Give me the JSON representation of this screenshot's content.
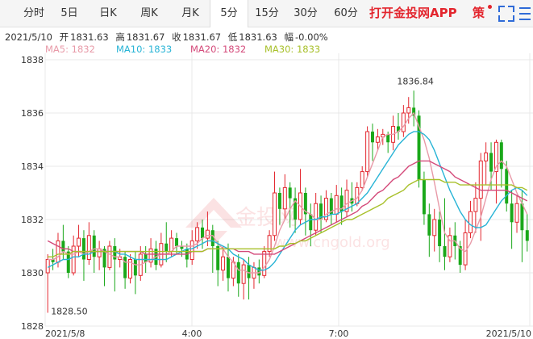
{
  "tabs": [
    "分时",
    "5日",
    "日K",
    "周K",
    "月K",
    "5分",
    "15分",
    "30分",
    "60分"
  ],
  "active_tab": 5,
  "app_link": "打开金投网APP",
  "strategy_label": "策",
  "quote": {
    "date": "2021/5/10",
    "open_label": "开",
    "open": "1831.63",
    "high_label": "高",
    "high": "1831.67",
    "close_label": "收",
    "close": "1831.67",
    "low_label": "低",
    "low": "1831.63",
    "range_label": "幅",
    "range": "-0.00%"
  },
  "ma": [
    {
      "label": "MA5: 1832",
      "color": "#e89aa8"
    },
    {
      "label": "MA10: 1833",
      "color": "#28b4d6"
    },
    {
      "label": "MA20: 1832",
      "color": "#d44a7a"
    },
    {
      "label": "MA30: 1833",
      "color": "#a8c02a"
    }
  ],
  "colors": {
    "up": "#e3262e",
    "down": "#1aa81a",
    "grid": "#e8e8e8",
    "watermark": "#e3262e"
  },
  "chart_data": {
    "type": "candlestick",
    "ylim": [
      1828,
      1838
    ],
    "yticks": [
      "1828",
      "1830",
      "1832",
      "1834",
      "1836",
      "1838"
    ],
    "xticks": [
      "2021/5/8",
      "4:00",
      "7:00",
      "2021/5/10"
    ],
    "max_label": "1836.84",
    "min_label": "1828.50",
    "candles": [
      [
        1830.0,
        1830.5,
        1828.5,
        1830.7
      ],
      [
        1830.5,
        1830.4,
        1830.1,
        1830.9
      ],
      [
        1830.4,
        1831.2,
        1830.2,
        1831.5
      ],
      [
        1831.2,
        1830.8,
        1830.5,
        1831.8
      ],
      [
        1830.8,
        1830.0,
        1829.8,
        1831.0
      ],
      [
        1830.0,
        1831.0,
        1829.9,
        1831.4
      ],
      [
        1831.0,
        1831.3,
        1830.6,
        1831.8
      ],
      [
        1831.3,
        1830.5,
        1829.7,
        1831.6
      ],
      [
        1830.5,
        1831.4,
        1830.3,
        1831.9
      ],
      [
        1831.4,
        1830.6,
        1830.0,
        1831.6
      ],
      [
        1830.6,
        1830.9,
        1830.1,
        1831.2
      ],
      [
        1830.9,
        1830.2,
        1829.5,
        1831.0
      ],
      [
        1830.2,
        1831.0,
        1830.1,
        1831.2
      ],
      [
        1831.0,
        1830.5,
        1829.3,
        1831.3
      ],
      [
        1830.5,
        1830.6,
        1830.2,
        1830.9
      ],
      [
        1830.6,
        1829.8,
        1829.4,
        1830.8
      ],
      [
        1829.8,
        1830.5,
        1829.6,
        1830.7
      ],
      [
        1830.5,
        1829.9,
        1829.2,
        1830.8
      ],
      [
        1829.9,
        1830.7,
        1829.7,
        1831.0
      ],
      [
        1830.7,
        1830.4,
        1830.0,
        1831.0
      ],
      [
        1830.4,
        1830.9,
        1830.2,
        1831.3
      ],
      [
        1830.9,
        1830.3,
        1830.1,
        1831.2
      ],
      [
        1830.3,
        1831.1,
        1830.2,
        1831.5
      ],
      [
        1831.1,
        1830.8,
        1830.4,
        1831.9
      ],
      [
        1830.8,
        1831.3,
        1830.6,
        1831.6
      ],
      [
        1831.3,
        1831.0,
        1830.7,
        1831.5
      ],
      [
        1831.0,
        1830.9,
        1830.6,
        1831.2
      ],
      [
        1830.9,
        1830.5,
        1830.2,
        1831.1
      ],
      [
        1830.5,
        1831.2,
        1830.3,
        1831.6
      ],
      [
        1831.2,
        1831.7,
        1830.9,
        1831.9
      ],
      [
        1831.7,
        1831.3,
        1830.9,
        1832.0
      ],
      [
        1831.3,
        1831.6,
        1831.0,
        1832.3
      ],
      [
        1831.6,
        1831.0,
        1830.0,
        1831.8
      ],
      [
        1831.0,
        1830.1,
        1829.5,
        1831.2
      ],
      [
        1830.1,
        1830.6,
        1829.7,
        1831.0
      ],
      [
        1830.6,
        1829.8,
        1829.3,
        1831.1
      ],
      [
        1829.8,
        1830.4,
        1829.5,
        1830.6
      ],
      [
        1830.4,
        1829.6,
        1829.1,
        1830.7
      ],
      [
        1829.6,
        1830.3,
        1829.0,
        1830.5
      ],
      [
        1830.3,
        1829.8,
        1829.0,
        1830.6
      ],
      [
        1829.8,
        1830.2,
        1829.4,
        1830.4
      ],
      [
        1830.2,
        1829.9,
        1829.6,
        1830.5
      ],
      [
        1829.9,
        1830.8,
        1829.8,
        1831.0
      ],
      [
        1830.8,
        1831.4,
        1830.6,
        1831.6
      ],
      [
        1831.4,
        1833.0,
        1831.2,
        1833.8
      ],
      [
        1833.0,
        1832.4,
        1831.8,
        1833.2
      ],
      [
        1832.4,
        1833.2,
        1832.0,
        1833.7
      ],
      [
        1833.2,
        1832.8,
        1831.7,
        1833.4
      ],
      [
        1832.8,
        1832.0,
        1831.5,
        1833.2
      ],
      [
        1832.0,
        1833.0,
        1831.8,
        1833.9
      ],
      [
        1833.0,
        1832.2,
        1831.4,
        1833.2
      ],
      [
        1832.2,
        1831.6,
        1831.0,
        1832.6
      ],
      [
        1831.6,
        1832.6,
        1831.4,
        1833.0
      ],
      [
        1832.6,
        1832.0,
        1831.5,
        1832.9
      ],
      [
        1832.0,
        1832.8,
        1831.9,
        1833.1
      ],
      [
        1832.8,
        1832.2,
        1831.8,
        1833.0
      ],
      [
        1832.2,
        1832.9,
        1831.9,
        1833.3
      ],
      [
        1832.9,
        1832.3,
        1831.8,
        1833.2
      ],
      [
        1832.3,
        1833.1,
        1832.1,
        1833.5
      ],
      [
        1832.8,
        1832.6,
        1832.3,
        1833.4
      ],
      [
        1832.6,
        1833.2,
        1832.5,
        1833.4
      ],
      [
        1833.2,
        1833.8,
        1833.1,
        1834.0
      ],
      [
        1833.8,
        1835.3,
        1833.6,
        1835.5
      ],
      [
        1835.3,
        1834.9,
        1834.2,
        1835.6
      ],
      [
        1834.9,
        1835.1,
        1834.6,
        1835.4
      ],
      [
        1835.1,
        1835.2,
        1834.8,
        1835.4
      ],
      [
        1835.2,
        1834.9,
        1834.5,
        1835.3
      ],
      [
        1834.9,
        1835.5,
        1834.6,
        1835.9
      ],
      [
        1835.5,
        1835.3,
        1835.0,
        1836.0
      ],
      [
        1835.3,
        1836.0,
        1835.1,
        1836.3
      ],
      [
        1836.0,
        1836.2,
        1835.6,
        1836.6
      ],
      [
        1836.2,
        1835.9,
        1835.5,
        1836.84
      ],
      [
        1835.9,
        1833.5,
        1833.2,
        1836.1
      ],
      [
        1833.5,
        1832.2,
        1831.8,
        1833.8
      ],
      [
        1832.2,
        1831.4,
        1830.6,
        1832.6
      ],
      [
        1831.4,
        1832.0,
        1830.8,
        1832.4
      ],
      [
        1832.0,
        1831.0,
        1830.4,
        1832.3
      ],
      [
        1831.0,
        1830.6,
        1830.1,
        1832.8
      ],
      [
        1830.6,
        1831.4,
        1830.4,
        1831.7
      ],
      [
        1831.4,
        1831.0,
        1830.5,
        1831.9
      ],
      [
        1831.0,
        1830.3,
        1830.0,
        1831.2
      ],
      [
        1830.3,
        1831.5,
        1830.1,
        1832.0
      ],
      [
        1831.5,
        1832.3,
        1831.3,
        1832.7
      ],
      [
        1832.3,
        1832.8,
        1831.5,
        1833.4
      ],
      [
        1832.8,
        1834.2,
        1831.2,
        1834.5
      ],
      [
        1834.2,
        1834.5,
        1833.3,
        1834.9
      ],
      [
        1834.5,
        1833.8,
        1833.1,
        1834.9
      ],
      [
        1833.8,
        1834.9,
        1832.6,
        1835.0
      ],
      [
        1834.9,
        1833.9,
        1833.2,
        1835.0
      ],
      [
        1833.9,
        1832.6,
        1832.3,
        1834.2
      ],
      [
        1832.6,
        1831.9,
        1830.9,
        1833.1
      ],
      [
        1831.9,
        1832.6,
        1831.5,
        1832.9
      ],
      [
        1832.6,
        1831.6,
        1830.4,
        1833.1
      ],
      [
        1831.6,
        1831.2,
        1830.8,
        1832.2
      ]
    ],
    "ma": {
      "MA5": [
        1830.5,
        1830.5,
        1830.6,
        1830.8,
        1830.7,
        1830.7,
        1830.8,
        1830.7,
        1830.8,
        1830.9,
        1830.9,
        1830.8,
        1830.7,
        1830.6,
        1830.6,
        1830.4,
        1830.4,
        1830.3,
        1830.3,
        1830.4,
        1830.5,
        1830.6,
        1830.7,
        1830.7,
        1830.8,
        1831.0,
        1831.0,
        1831.0,
        1831.0,
        1831.1,
        1831.3,
        1831.4,
        1831.4,
        1831.1,
        1830.9,
        1830.6,
        1830.4,
        1830.1,
        1830.1,
        1830.0,
        1830.0,
        1830.0,
        1830.2,
        1830.5,
        1831.0,
        1831.6,
        1832.0,
        1832.4,
        1832.7,
        1832.5,
        1832.3,
        1832.2,
        1832.0,
        1832.0,
        1832.2,
        1832.3,
        1832.4,
        1832.4,
        1832.6,
        1832.7,
        1832.8,
        1833.1,
        1833.6,
        1834.1,
        1834.6,
        1835.1,
        1835.2,
        1835.2,
        1835.3,
        1835.5,
        1835.8,
        1836.0,
        1835.5,
        1835.0,
        1834.3,
        1833.4,
        1832.4,
        1831.5,
        1831.2,
        1831.2,
        1830.9,
        1830.8,
        1831.1,
        1831.6,
        1832.1,
        1832.8,
        1833.5,
        1834.0,
        1834.2,
        1834.0,
        1833.5,
        1833.0,
        1832.6,
        1832.2
      ],
      "MA10": [
        1830.2,
        1830.3,
        1830.4,
        1830.5,
        1830.5,
        1830.6,
        1830.6,
        1830.7,
        1830.7,
        1830.8,
        1830.8,
        1830.8,
        1830.8,
        1830.8,
        1830.7,
        1830.7,
        1830.6,
        1830.5,
        1830.5,
        1830.5,
        1830.5,
        1830.5,
        1830.5,
        1830.5,
        1830.6,
        1830.7,
        1830.8,
        1830.9,
        1830.9,
        1831.0,
        1831.1,
        1831.2,
        1831.2,
        1831.1,
        1831.0,
        1830.9,
        1830.7,
        1830.6,
        1830.5,
        1830.3,
        1830.2,
        1830.1,
        1830.1,
        1830.2,
        1830.4,
        1830.7,
        1831.0,
        1831.3,
        1831.6,
        1831.8,
        1831.9,
        1832.0,
        1832.0,
        1832.1,
        1832.1,
        1832.2,
        1832.2,
        1832.3,
        1832.4,
        1832.5,
        1832.6,
        1832.8,
        1833.0,
        1833.3,
        1833.6,
        1833.9,
        1834.2,
        1834.5,
        1834.8,
        1835.0,
        1835.2,
        1835.3,
        1835.3,
        1835.2,
        1835.0,
        1834.6,
        1834.1,
        1833.6,
        1833.1,
        1832.7,
        1832.3,
        1832.0,
        1831.8,
        1831.7,
        1831.7,
        1831.8,
        1832.1,
        1832.4,
        1832.7,
        1832.9,
        1833.1,
        1833.2,
        1833.1,
        1832.9
      ],
      "MA20": [
        1831.2,
        1831.1,
        1831.0,
        1830.9,
        1830.9,
        1830.8,
        1830.8,
        1830.8,
        1830.8,
        1830.8,
        1830.8,
        1830.8,
        1830.8,
        1830.8,
        1830.8,
        1830.8,
        1830.8,
        1830.8,
        1830.8,
        1830.7,
        1830.7,
        1830.7,
        1830.7,
        1830.7,
        1830.7,
        1830.7,
        1830.7,
        1830.7,
        1830.8,
        1830.8,
        1830.8,
        1830.9,
        1830.9,
        1830.9,
        1830.9,
        1830.9,
        1830.9,
        1830.8,
        1830.8,
        1830.8,
        1830.7,
        1830.7,
        1830.7,
        1830.7,
        1830.7,
        1830.8,
        1830.9,
        1831.0,
        1831.1,
        1831.2,
        1831.3,
        1831.4,
        1831.5,
        1831.6,
        1831.7,
        1831.8,
        1831.9,
        1832.0,
        1832.1,
        1832.2,
        1832.3,
        1832.5,
        1832.6,
        1832.8,
        1833.0,
        1833.1,
        1833.3,
        1833.5,
        1833.6,
        1833.8,
        1834.0,
        1834.1,
        1834.2,
        1834.2,
        1834.2,
        1834.1,
        1834.0,
        1833.9,
        1833.8,
        1833.6,
        1833.5,
        1833.4,
        1833.3,
        1833.2,
        1833.1,
        1833.1,
        1833.1,
        1833.1,
        1833.1,
        1833.1,
        1833.0,
        1832.9,
        1832.8,
        1832.7
      ],
      "MA30": [
        1830.6,
        1830.6,
        1830.7,
        1830.7,
        1830.7,
        1830.8,
        1830.8,
        1830.8,
        1830.8,
        1830.8,
        1830.8,
        1830.8,
        1830.8,
        1830.8,
        1830.8,
        1830.8,
        1830.8,
        1830.8,
        1830.8,
        1830.8,
        1830.8,
        1830.8,
        1830.8,
        1830.8,
        1830.8,
        1830.8,
        1830.8,
        1830.8,
        1830.8,
        1830.8,
        1830.8,
        1830.9,
        1830.9,
        1830.9,
        1830.9,
        1830.9,
        1830.9,
        1830.9,
        1830.9,
        1830.9,
        1830.9,
        1830.9,
        1830.9,
        1830.9,
        1830.9,
        1831.0,
        1831.0,
        1831.1,
        1831.1,
        1831.2,
        1831.2,
        1831.3,
        1831.4,
        1831.5,
        1831.6,
        1831.7,
        1831.8,
        1831.9,
        1832.0,
        1832.0,
        1832.1,
        1832.2,
        1832.3,
        1832.4,
        1832.5,
        1832.6,
        1832.8,
        1832.9,
        1833.0,
        1833.1,
        1833.3,
        1833.4,
        1833.5,
        1833.5,
        1833.5,
        1833.5,
        1833.5,
        1833.4,
        1833.4,
        1833.4,
        1833.3,
        1833.3,
        1833.3,
        1833.3,
        1833.3,
        1833.3,
        1833.3,
        1833.3,
        1833.3,
        1833.3,
        1833.3,
        1833.2,
        1833.2,
        1833.1
      ]
    }
  }
}
